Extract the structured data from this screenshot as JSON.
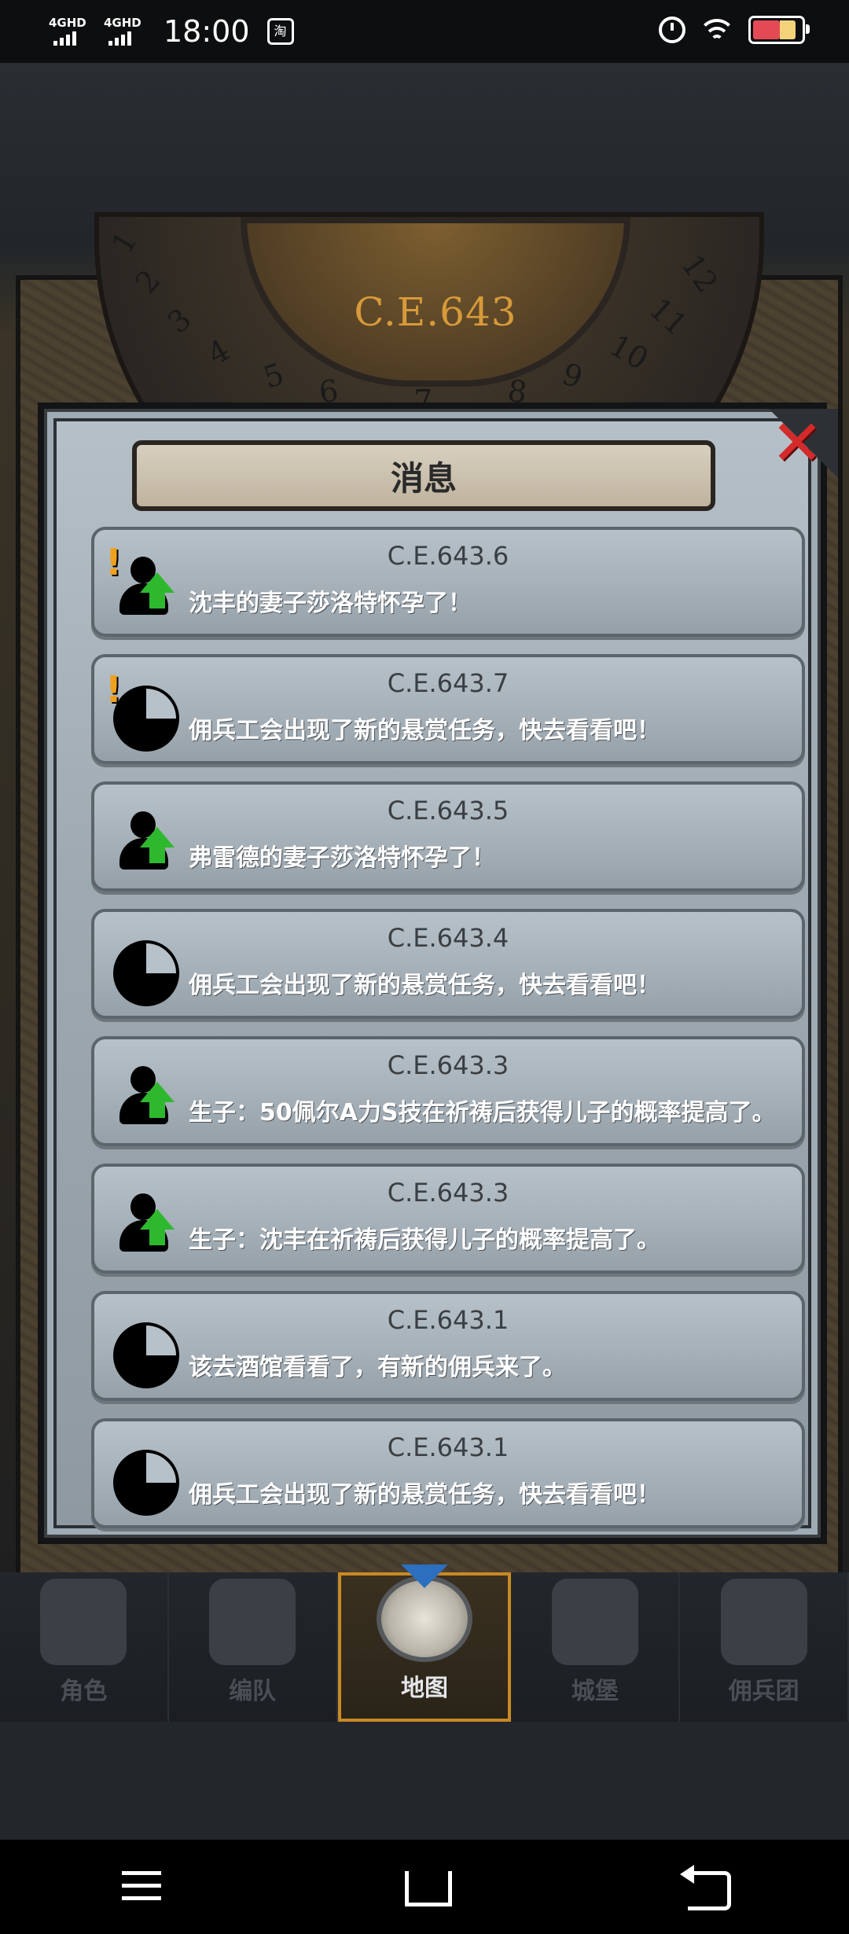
{
  "status_bar": {
    "network1": "4GHD",
    "network2": "4GHD",
    "time": "18:00",
    "app_badge": "淘"
  },
  "game": {
    "era_label": "C.E.643",
    "dial_numbers": [
      "1",
      "2",
      "3",
      "4",
      "5",
      "6",
      "7",
      "8",
      "9",
      "10",
      "11",
      "12"
    ]
  },
  "dialog": {
    "title": "消息",
    "messages": [
      {
        "date": "C.E.643.6",
        "text": "沈丰的妻子莎洛特怀孕了！",
        "icon": "person-up-icon",
        "alert": true
      },
      {
        "date": "C.E.643.7",
        "text": "佣兵工会出现了新的悬赏任务，快去看看吧！",
        "icon": "clock-pie-icon",
        "alert": true
      },
      {
        "date": "C.E.643.5",
        "text": "弗雷德的妻子莎洛特怀孕了！",
        "icon": "person-up-icon",
        "alert": false
      },
      {
        "date": "C.E.643.4",
        "text": "佣兵工会出现了新的悬赏任务，快去看看吧！",
        "icon": "clock-pie-icon",
        "alert": false
      },
      {
        "date": "C.E.643.3",
        "text": "生子：50佩尔A力S技在祈祷后获得儿子的概率提高了。",
        "icon": "person-up-icon",
        "alert": false
      },
      {
        "date": "C.E.643.3",
        "text": "生子：沈丰在祈祷后获得儿子的概率提高了。",
        "icon": "person-up-icon",
        "alert": false
      },
      {
        "date": "C.E.643.1",
        "text": "该去酒馆看看了，有新的佣兵来了。",
        "icon": "clock-pie-icon",
        "alert": false
      },
      {
        "date": "C.E.643.1",
        "text": "佣兵工会出现了新的悬赏任务，快去看看吧！",
        "icon": "clock-pie-icon",
        "alert": false
      }
    ]
  },
  "bottom_nav": {
    "items": [
      {
        "label": "角色",
        "active": false
      },
      {
        "label": "编队",
        "active": false
      },
      {
        "label": "地图",
        "active": true
      },
      {
        "label": "城堡",
        "active": false
      },
      {
        "label": "佣兵团",
        "active": false
      }
    ]
  },
  "colors": {
    "alert": "#f0a01c",
    "arrow_up": "#2eb82e",
    "close": "#d42a2a",
    "nav_active_border": "#c88a24",
    "era_text": "#d89a3a"
  }
}
